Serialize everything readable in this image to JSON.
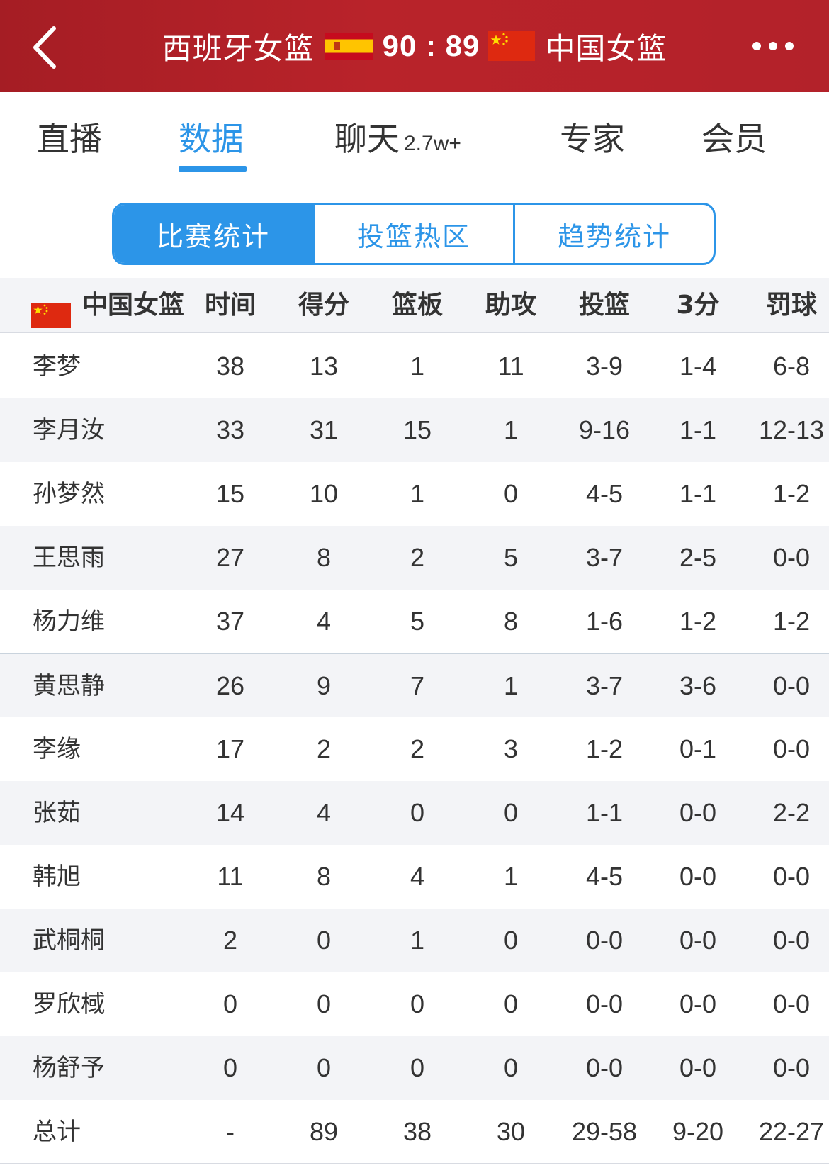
{
  "header": {
    "home_team": "西班牙女篮",
    "away_team": "中国女篮",
    "score": "90 : 89",
    "home_flag_icon": "spain-flag-icon",
    "away_flag_icon": "china-flag-icon",
    "bg_color": "#b3222a"
  },
  "main_tabs": [
    {
      "label": "直播",
      "count": ""
    },
    {
      "label": "数据",
      "count": ""
    },
    {
      "label": "聊天",
      "count": "2.7w+"
    },
    {
      "label": "专家",
      "count": ""
    },
    {
      "label": "会员",
      "count": ""
    }
  ],
  "active_main_tab": "数据",
  "sub_tabs": [
    "比赛统计",
    "投篮热区",
    "趋势统计"
  ],
  "active_sub_tab": "比赛统计",
  "accent_color": "#2c95e8",
  "table": {
    "team": "中国女篮",
    "columns": [
      "时间",
      "得分",
      "篮板",
      "助攻",
      "投篮",
      "3分",
      "罚球"
    ],
    "rows": [
      {
        "name": "李梦",
        "stats": [
          "38",
          "13",
          "1",
          "11",
          "3-9",
          "1-4",
          "6-8"
        ]
      },
      {
        "name": "李月汝",
        "stats": [
          "33",
          "31",
          "15",
          "1",
          "9-16",
          "1-1",
          "12-13"
        ]
      },
      {
        "name": "孙梦然",
        "stats": [
          "15",
          "10",
          "1",
          "0",
          "4-5",
          "1-1",
          "1-2"
        ]
      },
      {
        "name": "王思雨",
        "stats": [
          "27",
          "8",
          "2",
          "5",
          "3-7",
          "2-5",
          "0-0"
        ]
      },
      {
        "name": "杨力维",
        "stats": [
          "37",
          "4",
          "5",
          "8",
          "1-6",
          "1-2",
          "1-2"
        ]
      },
      {
        "name": "黄思静",
        "stats": [
          "26",
          "9",
          "7",
          "1",
          "3-7",
          "3-6",
          "0-0"
        ]
      },
      {
        "name": "李缘",
        "stats": [
          "17",
          "2",
          "2",
          "3",
          "1-2",
          "0-1",
          "0-0"
        ]
      },
      {
        "name": "张茹",
        "stats": [
          "14",
          "4",
          "0",
          "0",
          "1-1",
          "0-0",
          "2-2"
        ]
      },
      {
        "name": "韩旭",
        "stats": [
          "11",
          "8",
          "4",
          "1",
          "4-5",
          "0-0",
          "0-0"
        ]
      },
      {
        "name": "武桐桐",
        "stats": [
          "2",
          "0",
          "1",
          "0",
          "0-0",
          "0-0",
          "0-0"
        ]
      },
      {
        "name": "罗欣棫",
        "stats": [
          "0",
          "0",
          "0",
          "0",
          "0-0",
          "0-0",
          "0-0"
        ]
      },
      {
        "name": "杨舒予",
        "stats": [
          "0",
          "0",
          "0",
          "0",
          "0-0",
          "0-0",
          "0-0"
        ]
      }
    ],
    "total": {
      "name": "总计",
      "stats": [
        "-",
        "89",
        "38",
        "30",
        "29-58",
        "9-20",
        "22-27"
      ]
    }
  }
}
